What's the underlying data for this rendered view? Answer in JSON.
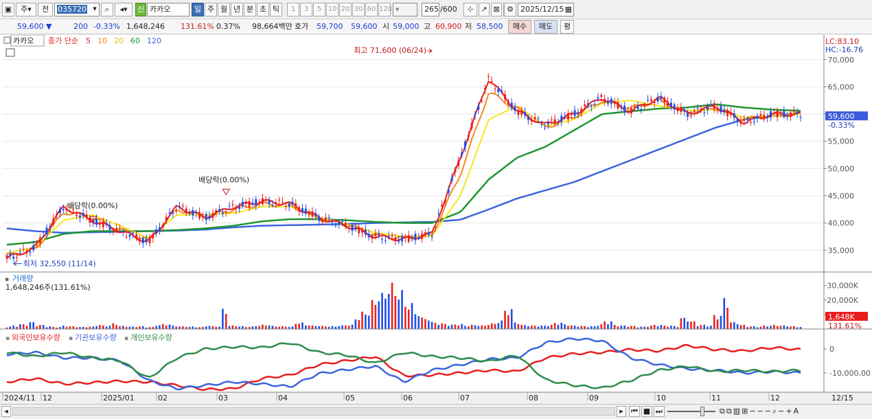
{
  "toolbar": {
    "period_label": "주",
    "prev_label": "전",
    "code": "035720",
    "new_badge": "신",
    "stock_name": "카카오",
    "interval_tabs": [
      "일",
      "주",
      "월",
      "년",
      "분",
      "초",
      "틱"
    ],
    "number_tabs": [
      "1",
      "3",
      "5",
      "10",
      "20",
      "30",
      "60",
      "120"
    ],
    "count": "265",
    "count_max": "/600",
    "date": "2025/12/15"
  },
  "quote": {
    "price": "59,600",
    "arrow": "▼",
    "change": "200",
    "change_rate": "-0.33%",
    "volume": "1,648,246",
    "volume_ratio": "131.61%",
    "turnover": "0.37%",
    "amount": "98,664백만",
    "ask_label": "호가",
    "ask": "59,700",
    "bid": "59,600",
    "open_label": "시",
    "open": "59,000",
    "high_label": "고",
    "high": "60,900",
    "low_label": "저",
    "low": "58,500",
    "buy_label": "매수",
    "sell_label": "매도",
    "eval_label": "평"
  },
  "legend": {
    "stock": "카카오",
    "ma_prefix": "종가 단순",
    "ma_periods": [
      "5",
      "10",
      "20",
      "60",
      "120"
    ]
  },
  "colors": {
    "candle_up": "#e8221e",
    "candle_down": "#1e4fe8",
    "ma5": "#e81e1e",
    "ma10": "#f08c1e",
    "ma20": "#f5e61e",
    "ma60": "#1e9632",
    "ma120": "#3c64dc",
    "foreign": "#e81e1e",
    "institution": "#3c64dc",
    "individual": "#2e8b4b",
    "price_box": "#3c5adc",
    "volume_box": "#e81e1e"
  },
  "chart_data": [
    {
      "type": "candlestick",
      "title": "카카오",
      "x": [
        "2024/11",
        "12",
        "2025/01",
        "02",
        "03",
        "04",
        "05",
        "06",
        "07",
        "08",
        "09",
        "10",
        "11",
        "12"
      ],
      "y_ticks": [
        "35,000",
        "40,000",
        "45,000",
        "50,000",
        "55,000",
        "60,000",
        "65,000",
        "70,000"
      ],
      "ylim": [
        31000,
        73500
      ],
      "series": [
        {
          "name": "5",
          "values": [
            33500,
            35500,
            43000,
            40500,
            38500,
            36500,
            43000,
            41000,
            43000,
            44000,
            43500,
            41000,
            39500,
            37500,
            37000,
            38000,
            52000,
            66500,
            60500,
            58000,
            60000,
            63000,
            60500,
            63000,
            60000,
            61500,
            58500,
            60000,
            60000
          ]
        },
        {
          "name": "10",
          "values": [
            34000,
            35000,
            42000,
            41000,
            38800,
            36800,
            42500,
            41200,
            42500,
            43500,
            43300,
            40800,
            39700,
            37800,
            37200,
            37800,
            49000,
            64000,
            61000,
            57500,
            59500,
            62500,
            61000,
            62500,
            60200,
            61200,
            59000,
            59800,
            60000
          ]
        },
        {
          "name": "20",
          "values": [
            34500,
            35500,
            40500,
            41500,
            39500,
            37200,
            41500,
            41500,
            41800,
            43000,
            43000,
            41000,
            39800,
            38200,
            37500,
            37600,
            45000,
            59000,
            61500,
            57800,
            59000,
            62000,
            62500,
            61500,
            60600,
            60800,
            59400,
            59600,
            60000
          ]
        },
        {
          "name": "60",
          "values": [
            36000,
            36500,
            38000,
            38500,
            38500,
            38500,
            38700,
            39000,
            39500,
            40300,
            40700,
            40700,
            40500,
            40200,
            40000,
            40000,
            42000,
            48000,
            52000,
            54000,
            57000,
            60000,
            60500,
            61000,
            61200,
            61800,
            61200,
            60800,
            60600
          ]
        },
        {
          "name": "120",
          "values": [
            39000,
            38500,
            38200,
            38300,
            38400,
            38500,
            38600,
            38800,
            39200,
            39500,
            39600,
            39700,
            39800,
            40000,
            40100,
            40200,
            40600,
            42500,
            44500,
            46000,
            47500,
            49500,
            51500,
            53500,
            55500,
            57500,
            59000,
            59600,
            60200
          ]
        }
      ],
      "annotations": [
        {
          "text": "최고 71,600 (06/24)",
          "value": 71600
        },
        {
          "text": "최저 32,550 (11/14)",
          "value": 32550
        },
        {
          "text": "배당락(0.00%)"
        },
        {
          "text": "배당락(0.00%)"
        }
      ],
      "right_labels": {
        "lc": "LC:83.10",
        "hc": "HC:-16.76",
        "price": "59,600",
        "rate": "-0.33%"
      }
    },
    {
      "type": "bar",
      "title": "거래량",
      "subtitle": "1,648,246주(131.61%)",
      "y_ticks": [
        "10,000K",
        "20,000K",
        "30,000K"
      ],
      "ylim": [
        0,
        36000
      ],
      "unit": "K",
      "values": [
        1800,
        2500,
        3500,
        5000,
        3000,
        2000,
        1500,
        2500,
        2000,
        1500,
        1800,
        3000,
        2500,
        4000,
        2200,
        1800,
        2000,
        1500,
        3000,
        3500,
        2500,
        2000,
        1800,
        1500,
        2500,
        2000,
        14000,
        2500,
        2000,
        1800,
        2500,
        3000,
        2200,
        2000,
        1800,
        4500,
        3000,
        2500,
        2200,
        2000,
        2500,
        3000,
        8000,
        12000,
        20000,
        25000,
        32000,
        27000,
        18000,
        12000,
        8000,
        5000,
        4000,
        3000,
        3500,
        2500,
        3000,
        2500,
        4000,
        6000,
        14000,
        5000,
        3000,
        2500,
        2500,
        3000,
        4500,
        3500,
        2500,
        2200,
        2000,
        3500,
        5500,
        3000,
        2500,
        2200,
        1800,
        2500,
        3000,
        2500,
        2200,
        8000,
        5500,
        3000,
        2500,
        10000,
        22000,
        5000,
        3000,
        2000,
        1800,
        2500,
        3000,
        2500,
        2000,
        1648
      ],
      "right_labels": {
        "current": "1,648K",
        "rate": "131.61%"
      }
    },
    {
      "type": "line",
      "series": [
        {
          "name": "외국인보유수량"
        },
        {
          "name": "기관보유수량"
        },
        {
          "name": "개인보유수량"
        }
      ],
      "y_ticks": [
        "0",
        "-10,000,00"
      ]
    }
  ],
  "xaxis": {
    "months": [
      "2024/11",
      "12",
      "2025/01",
      "02",
      "03",
      "04",
      "05",
      "06",
      "07",
      "08",
      "09",
      "10",
      "11",
      "12"
    ],
    "current": "12/15"
  }
}
